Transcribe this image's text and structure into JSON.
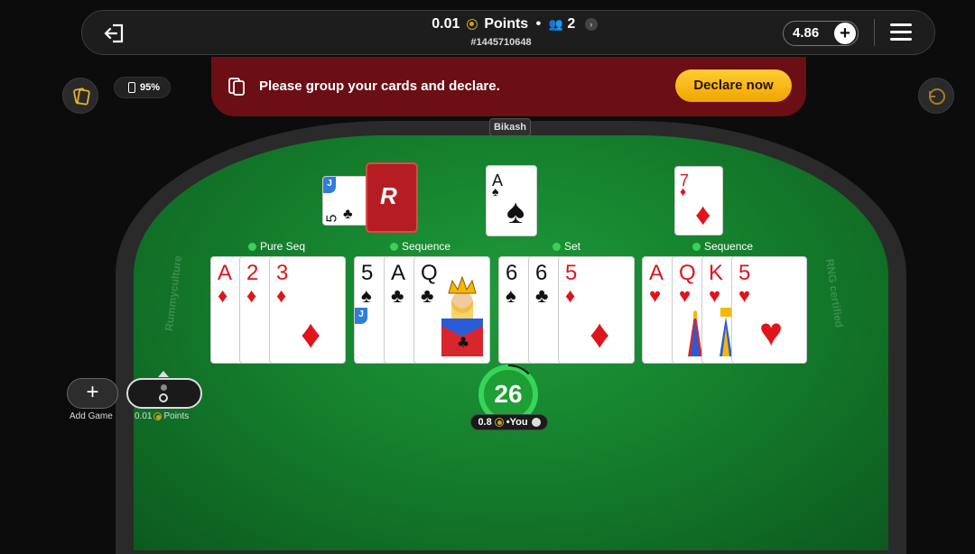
{
  "header": {
    "stake": "0.01",
    "points_label": "Points",
    "bullet": "•",
    "players": "2",
    "game_id": "#1445710648",
    "balance": "4.86",
    "add_label": "+"
  },
  "status": {
    "battery_pct": "95%"
  },
  "banner": {
    "message": "Please group your cards and declare.",
    "declare_label": "Declare now"
  },
  "table": {
    "opponent_name": "Bikash",
    "watermark_left": "Rummyculture",
    "watermark_right": "RNG certified"
  },
  "open_cards": {
    "joker_card": {
      "rank": "5",
      "suit": "♣"
    },
    "open_card_1": {
      "rank": "A",
      "suit": "♠"
    },
    "open_card_2": {
      "rank": "7",
      "suit": "♦"
    }
  },
  "groups": [
    {
      "label": "Pure Seq",
      "cards": [
        {
          "rank": "A",
          "suit": "♦"
        },
        {
          "rank": "2",
          "suit": "♦"
        },
        {
          "rank": "3",
          "suit": "♦"
        }
      ]
    },
    {
      "label": "Sequence",
      "cards": [
        {
          "rank": "5",
          "suit": "♠"
        },
        {
          "rank": "A",
          "suit": "♣"
        },
        {
          "rank": "Q",
          "suit": "♣"
        }
      ]
    },
    {
      "label": "Set",
      "cards": [
        {
          "rank": "6",
          "suit": "♠"
        },
        {
          "rank": "6",
          "suit": "♣"
        },
        {
          "rank": "5",
          "suit": "♦"
        }
      ]
    },
    {
      "label": "Sequence",
      "cards": [
        {
          "rank": "A",
          "suit": "♥"
        },
        {
          "rank": "Q",
          "suit": "♥"
        },
        {
          "rank": "K",
          "suit": "♥"
        },
        {
          "rank": "5",
          "suit": "♥"
        }
      ]
    }
  ],
  "player": {
    "score": "26",
    "points": "0.8",
    "you_label": "•You"
  },
  "bottom": {
    "add_game_label": "Add Game",
    "tab_stake": "0.01",
    "tab_points": "Points"
  },
  "colors": {
    "felt": "#15802d",
    "banner": "#6b0f14",
    "declare": "#f5b31c",
    "joker_tag": "#2f7de1"
  }
}
